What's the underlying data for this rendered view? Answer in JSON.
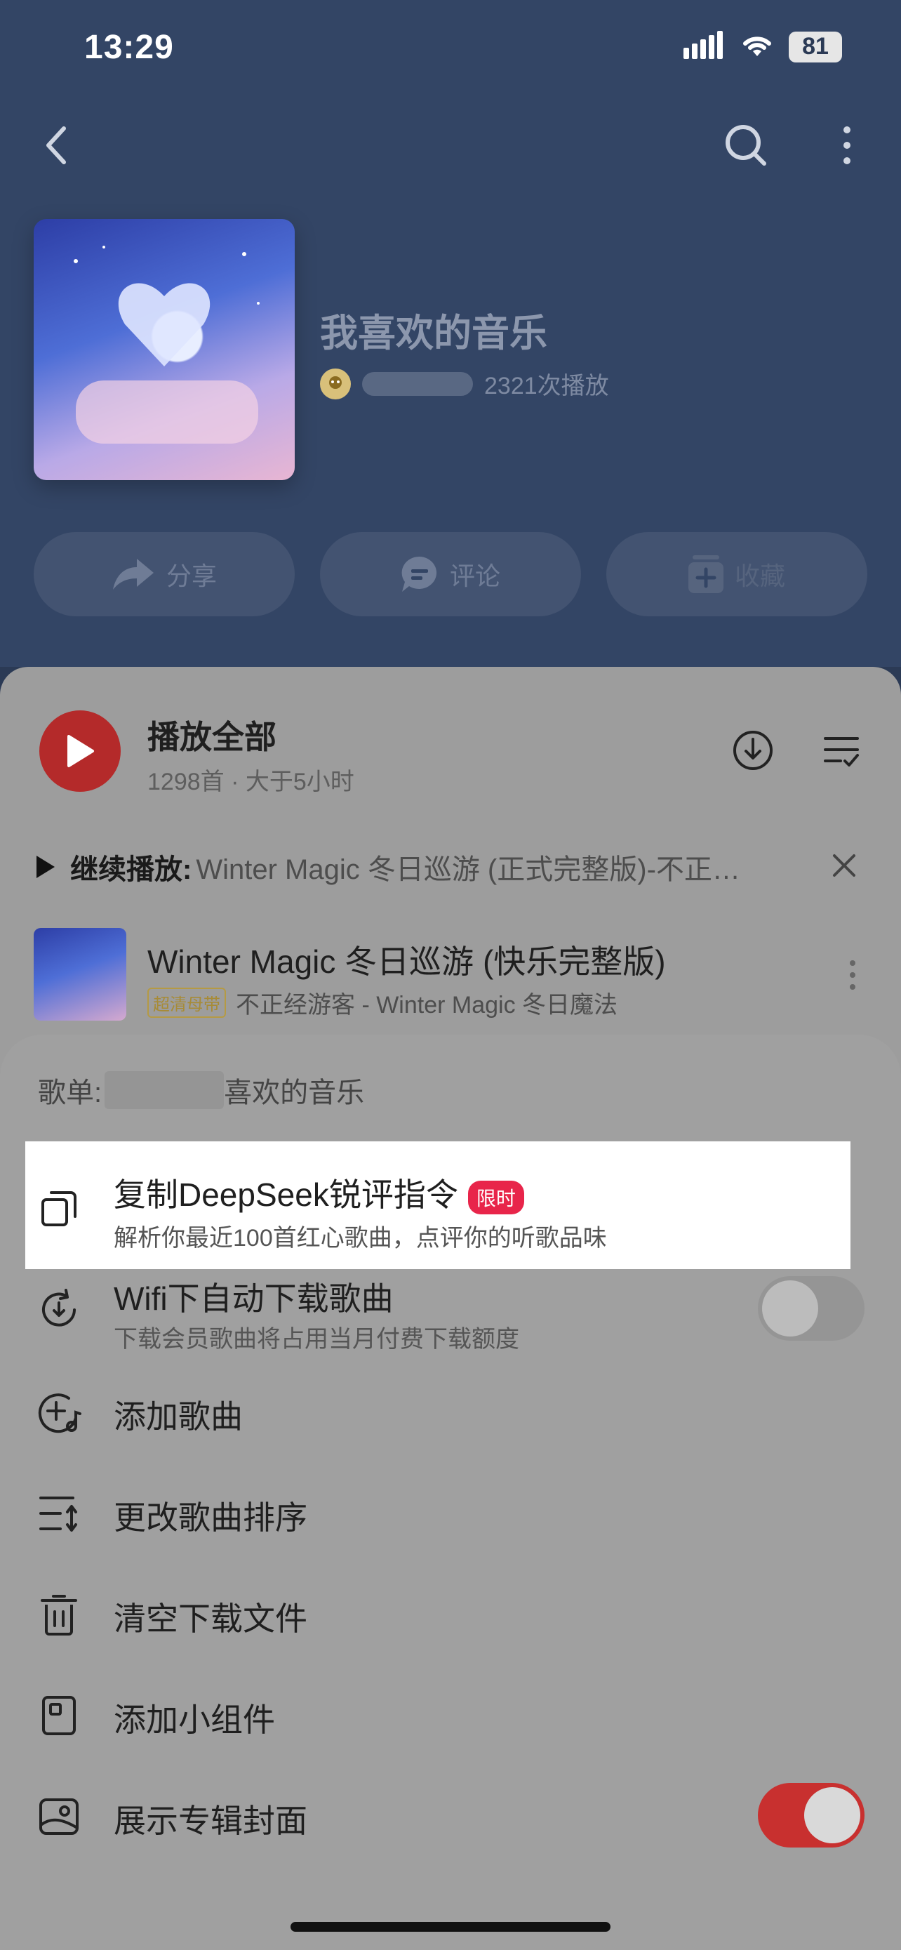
{
  "status_bar": {
    "time": "13:29",
    "battery": "81"
  },
  "header": {
    "playlist_title": "我喜欢的音乐",
    "play_count": "2321次播放",
    "actions": [
      {
        "label": "分享",
        "icon": "share-icon"
      },
      {
        "label": "评论",
        "icon": "comment-icon"
      },
      {
        "label": "收藏",
        "icon": "collect-icon"
      }
    ]
  },
  "list": {
    "play_all_label": "播放全部",
    "play_all_meta": "1298首 · 大于5小时",
    "continue_label": "继续播放:",
    "continue_song": "Winter Magic 冬日巡游 (正式完整版)-不正…",
    "songs": [
      {
        "title": "Winter Magic 冬日巡游 (快乐完整版)",
        "badge": "超清母带",
        "artist": "不正经游客 - Winter Magic 冬日魔法"
      }
    ]
  },
  "sheet": {
    "header_prefix": "歌单:",
    "header_suffix": "喜欢的音乐",
    "items": [
      {
        "title": "复制DeepSeek锐评指令",
        "badge": "限时",
        "subtitle": "解析你最近100首红心歌曲，点评你的听歌品味",
        "icon": "copy-icon"
      },
      {
        "title": "Wifi下自动下载歌曲",
        "subtitle": "下载会员歌曲将占用当月付费下载额度",
        "icon": "auto-download-icon",
        "toggle": "off"
      },
      {
        "title": "添加歌曲",
        "icon": "add-song-icon"
      },
      {
        "title": "更改歌曲排序",
        "icon": "sort-icon"
      },
      {
        "title": "清空下载文件",
        "icon": "trash-icon"
      },
      {
        "title": "添加小组件",
        "icon": "widget-icon"
      },
      {
        "title": "展示专辑封面",
        "icon": "album-cover-icon",
        "toggle": "on"
      }
    ]
  },
  "colors": {
    "accent_red": "#c8302f",
    "badge_red": "#e8254a"
  }
}
